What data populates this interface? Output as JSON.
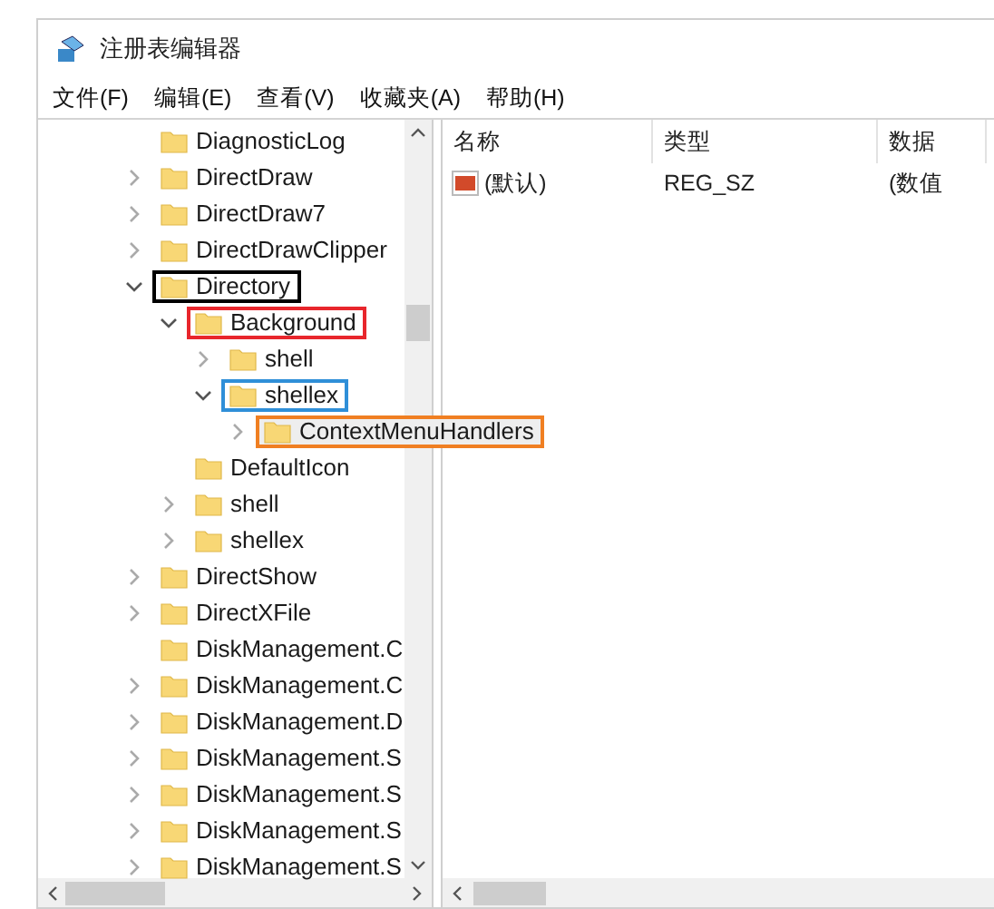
{
  "window": {
    "title": "注册表编辑器"
  },
  "menu": [
    "文件(F)",
    "编辑(E)",
    "查看(V)",
    "收藏夹(A)",
    "帮助(H)"
  ],
  "tree": [
    {
      "name": "DiagnosticLog",
      "kind": "leaf",
      "selected": false
    },
    {
      "name": "DirectDraw",
      "kind": "collapsed",
      "selected": false
    },
    {
      "name": "DirectDraw7",
      "kind": "collapsed",
      "selected": false
    },
    {
      "name": "DirectDrawClipper",
      "kind": "collapsed",
      "selected": false
    },
    {
      "name": "Directory",
      "kind": "expanded",
      "selected": false,
      "color": "#000000",
      "children": [
        {
          "name": "Background",
          "kind": "expanded",
          "selected": false,
          "color": "#e8262c",
          "children": [
            {
              "name": "shell",
              "kind": "collapsed",
              "selected": false
            },
            {
              "name": "shellex",
              "kind": "expanded",
              "selected": false,
              "color": "#2f8fd8",
              "children": [
                {
                  "name": "ContextMenuHandlers",
                  "kind": "collapsed",
                  "selected": true,
                  "color": "#f07f22"
                }
              ]
            }
          ]
        },
        {
          "name": "DefaultIcon",
          "kind": "leaf",
          "selected": false
        },
        {
          "name": "shell",
          "kind": "collapsed",
          "selected": false
        },
        {
          "name": "shellex",
          "kind": "collapsed",
          "selected": false
        }
      ]
    },
    {
      "name": "DirectShow",
      "kind": "collapsed",
      "selected": false
    },
    {
      "name": "DirectXFile",
      "kind": "collapsed",
      "selected": false
    },
    {
      "name": "DiskManagement.C",
      "kind": "leaf",
      "selected": false
    },
    {
      "name": "DiskManagement.C",
      "kind": "collapsed",
      "selected": false
    },
    {
      "name": "DiskManagement.D",
      "kind": "collapsed",
      "selected": false
    },
    {
      "name": "DiskManagement.S",
      "kind": "collapsed",
      "selected": false
    },
    {
      "name": "DiskManagement.S",
      "kind": "collapsed",
      "selected": false
    },
    {
      "name": "DiskManagement.S",
      "kind": "collapsed",
      "selected": false
    },
    {
      "name": "DiskManagement.S",
      "kind": "collapsed",
      "selected": false
    }
  ],
  "list": {
    "columns": [
      "名称",
      "类型",
      "数据"
    ],
    "rows": [
      {
        "name": "(默认)",
        "type": "REG_SZ",
        "data": "(数值"
      }
    ]
  }
}
